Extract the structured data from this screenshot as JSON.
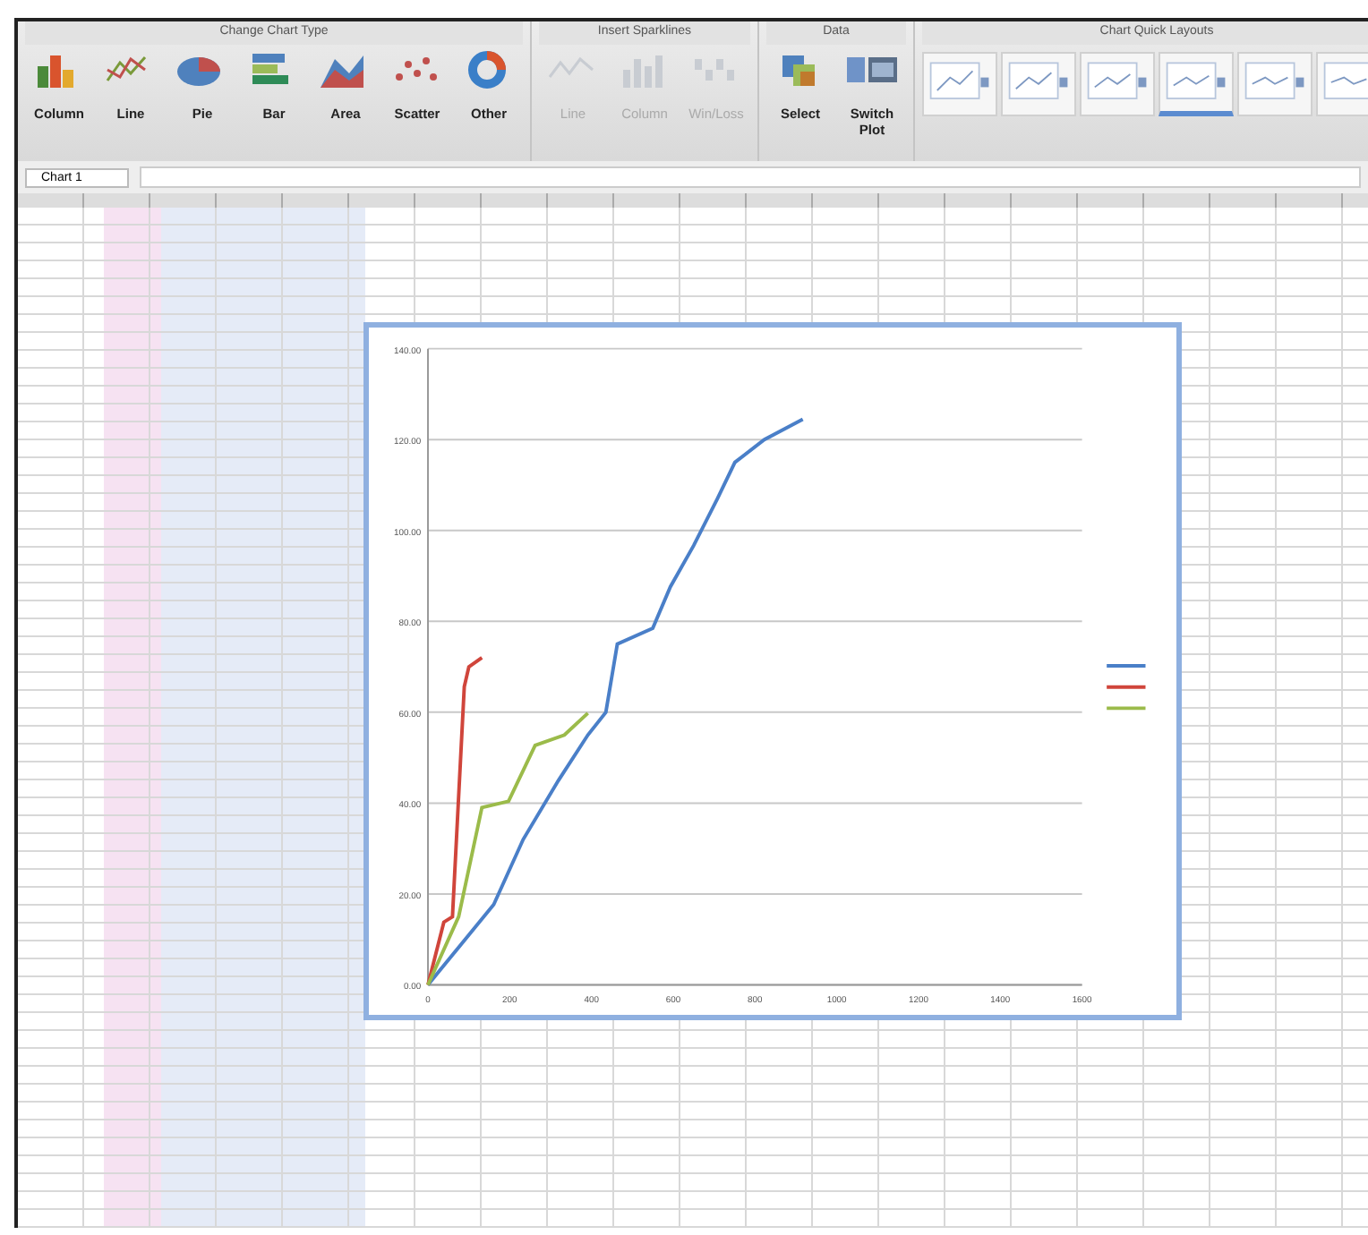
{
  "ribbon": {
    "groups": [
      {
        "title": "Change Chart Type",
        "buttons": [
          {
            "kind": "column",
            "label": "Column",
            "disabled": false
          },
          {
            "kind": "line",
            "label": "Line",
            "disabled": false
          },
          {
            "kind": "pie",
            "label": "Pie",
            "disabled": false
          },
          {
            "kind": "bar",
            "label": "Bar",
            "disabled": false
          },
          {
            "kind": "area",
            "label": "Area",
            "disabled": false
          },
          {
            "kind": "scatter",
            "label": "Scatter",
            "disabled": false
          },
          {
            "kind": "other",
            "label": "Other",
            "disabled": false
          }
        ]
      },
      {
        "title": "Insert Sparklines",
        "buttons": [
          {
            "kind": "spark-line",
            "label": "Line",
            "disabled": true
          },
          {
            "kind": "spark-column",
            "label": "Column",
            "disabled": true
          },
          {
            "kind": "winloss",
            "label": "Win/Loss",
            "disabled": true
          }
        ]
      },
      {
        "title": "Data",
        "buttons": [
          {
            "kind": "select",
            "label": "Select",
            "disabled": false
          },
          {
            "kind": "switch",
            "label": "Switch Plot",
            "disabled": false
          }
        ]
      }
    ],
    "quick_layouts": {
      "title": "Chart Quick Layouts",
      "items": [
        {
          "selected": false
        },
        {
          "selected": false
        },
        {
          "selected": false
        },
        {
          "selected": true
        },
        {
          "selected": false
        },
        {
          "selected": false
        }
      ]
    }
  },
  "name_box": {
    "value": "Chart 1"
  },
  "chart": {
    "chart_data": {
      "type": "line",
      "xticks": [
        {
          "value": 0,
          "label": "0"
        },
        {
          "value": 200,
          "label": "200"
        },
        {
          "value": 400,
          "label": "400"
        },
        {
          "value": 600,
          "label": "600"
        },
        {
          "value": 800,
          "label": "800"
        },
        {
          "value": 1000,
          "label": "1000"
        },
        {
          "value": 1200,
          "label": "1200"
        },
        {
          "value": 1400,
          "label": "1400"
        },
        {
          "value": 1600,
          "label": "1600"
        }
      ],
      "yticks": [
        {
          "value": 0,
          "label": "0.00"
        },
        {
          "value": 20,
          "label": "20.00"
        },
        {
          "value": 40,
          "label": "40.00"
        },
        {
          "value": 60,
          "label": "60.00"
        },
        {
          "value": 80,
          "label": "80.00"
        },
        {
          "value": 100,
          "label": "100.00"
        },
        {
          "value": 120,
          "label": "120.00"
        },
        {
          "value": 140,
          "label": "140.00"
        }
      ],
      "xlim": [
        0,
        1600
      ],
      "ylim": [
        0,
        140
      ],
      "grid": true,
      "series": [
        {
          "color": "#4a7fc8",
          "x": [
            0,
            161,
            233,
            319,
            391,
            435,
            463,
            550,
            593,
            650,
            708,
            751,
            823,
            917
          ],
          "values": [
            0,
            17.7,
            32,
            45,
            55,
            60,
            75,
            78.5,
            87.6,
            96.7,
            107,
            115,
            120,
            124.5
          ]
        },
        {
          "color": "#d0453b",
          "x": [
            0,
            39,
            60,
            89,
            100,
            132
          ],
          "values": [
            0,
            13.8,
            15,
            65.6,
            70,
            72
          ]
        },
        {
          "color": "#9bbb4a",
          "x": [
            0,
            75,
            132,
            197,
            262,
            334,
            391
          ],
          "values": [
            0,
            15,
            39,
            40.4,
            52.7,
            55,
            59.8
          ]
        }
      ]
    }
  }
}
